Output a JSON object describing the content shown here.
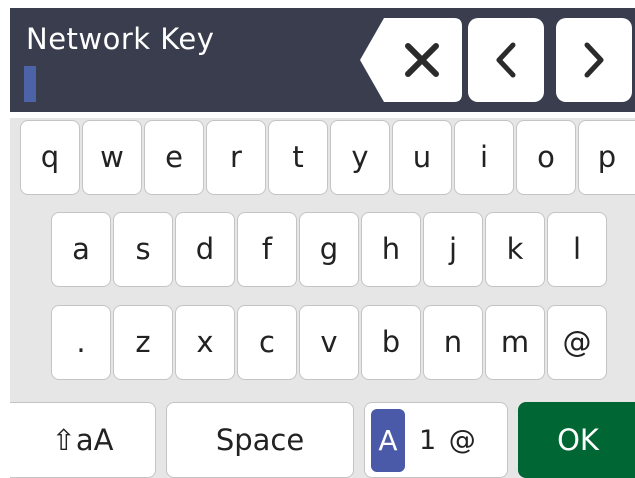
{
  "input": {
    "title": "Network Key",
    "value": ""
  },
  "keys": {
    "row1": [
      "q",
      "w",
      "e",
      "r",
      "t",
      "y",
      "u",
      "i",
      "o",
      "p"
    ],
    "row2": [
      "a",
      "s",
      "d",
      "f",
      "g",
      "h",
      "j",
      "k",
      "l"
    ],
    "row3": [
      ".",
      "z",
      "x",
      "c",
      "v",
      "b",
      "n",
      "m",
      "@"
    ]
  },
  "bottom": {
    "shift_label": "⇧aA",
    "space_label": "Space",
    "mode_active": "A",
    "mode_rest": "1 @",
    "ok_label": "OK"
  },
  "icons": {
    "backspace": "backspace-icon",
    "left": "chevron-left-icon",
    "right": "chevron-right-icon"
  },
  "colors": {
    "panel": "#3a3d4e",
    "cursor": "#4d63a8",
    "mode_active": "#4a5aa8",
    "ok": "#006633",
    "keyboard_bg": "#e6e6e6"
  }
}
